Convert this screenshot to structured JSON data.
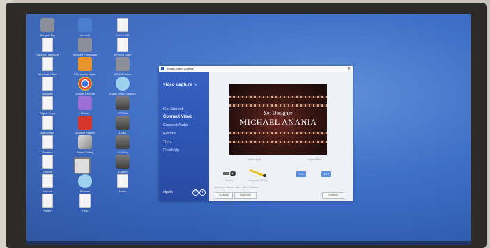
{
  "desktop": {
    "icons": [
      {
        "label": "Recycle Bin",
        "icon": "recycle-bin-icon",
        "kind": "gray"
      },
      {
        "label": "Acrobat",
        "icon": "acrobat-icon",
        "kind": "blue"
      },
      {
        "label": "Canon MG",
        "icon": "document-icon",
        "kind": "doc"
      },
      {
        "label": "Canon IJ Network",
        "icon": "document-icon",
        "kind": "doc"
      },
      {
        "label": "SimpleTV Software",
        "icon": "app-icon",
        "kind": "gray"
      },
      {
        "label": "EPSON Scan",
        "icon": "document-icon",
        "kind": "doc"
      },
      {
        "label": "Microsoft Office",
        "icon": "document-icon",
        "kind": "doc"
      },
      {
        "label": "VLC media player",
        "icon": "vlc-icon",
        "kind": "orange"
      },
      {
        "label": "EPSON Scan",
        "icon": "scanner-icon",
        "kind": "gray"
      },
      {
        "label": "Audacity",
        "icon": "document-icon",
        "kind": "doc"
      },
      {
        "label": "Google Chrome",
        "icon": "chrome-icon",
        "kind": "chrome"
      },
      {
        "label": "Elgato Video Capture",
        "icon": "elgato-icon",
        "kind": "lightblue"
      },
      {
        "label": "Digital Copy",
        "icon": "document-icon",
        "kind": "doc"
      },
      {
        "label": "Firefox",
        "icon": "firefox-icon",
        "kind": "purple"
      },
      {
        "label": "ACDSee",
        "icon": "cable-icon",
        "kind": "cable"
      },
      {
        "label": "Instructions",
        "icon": "document-icon",
        "kind": "doc"
      },
      {
        "label": "Acrobat Reader",
        "icon": "pdf-icon",
        "kind": "red"
      },
      {
        "label": "HDMI",
        "icon": "cable-icon",
        "kind": "cable"
      },
      {
        "label": "Readme",
        "icon": "document-icon",
        "kind": "doc"
      },
      {
        "label": "Photo Gallery",
        "icon": "picture-icon",
        "kind": "img"
      },
      {
        "label": "S-Video",
        "icon": "cable-icon",
        "kind": "cable"
      },
      {
        "label": "Tutorial",
        "icon": "document-icon",
        "kind": "doc"
      },
      {
        "label": "Monitor",
        "icon": "monitor-icon",
        "kind": "monitor"
      },
      {
        "label": "Cables",
        "icon": "cable-icon",
        "kind": "cable"
      },
      {
        "label": "Manual",
        "icon": "document-icon",
        "kind": "doc"
      },
      {
        "label": "Network",
        "icon": "network-icon",
        "kind": "lightblue"
      },
      {
        "label": "Notes",
        "icon": "document-icon",
        "kind": "doc"
      },
      {
        "label": "Folder",
        "icon": "document-icon",
        "kind": "doc"
      },
      {
        "label": "Help",
        "icon": "document-icon",
        "kind": "doc"
      }
    ]
  },
  "window": {
    "title": "Elgato Video Capture",
    "close": "✕",
    "brand": "video capture",
    "brand_wave": "∿",
    "steps": [
      {
        "label": "Get Started",
        "active": false
      },
      {
        "label": "Connect Video",
        "active": true
      },
      {
        "label": "Connect Audio",
        "active": false
      },
      {
        "label": "Record",
        "active": false
      },
      {
        "label": "Trim",
        "active": false
      },
      {
        "label": "Finish Up",
        "active": false
      }
    ],
    "footer_brand": "elgato",
    "help": "?",
    "info": "i",
    "preview": {
      "line1": "Set Designer",
      "line2": "MICHAEL ANANIA"
    },
    "left_caption": "Video Input",
    "right_caption": "Aspect Ratio",
    "input_label_1": "S-Video",
    "input_label_2": "Composite (RCA)",
    "ratio_1": "4:3",
    "ratio_2": "16:9",
    "hint": "When you can see video, click \"Continue\".",
    "buttons": {
      "back": "Go Back",
      "start_over": "Start Over",
      "continue": "Continue"
    }
  },
  "colors": {
    "accent": "#3660c2",
    "wallpaper": "#3f70c8"
  }
}
